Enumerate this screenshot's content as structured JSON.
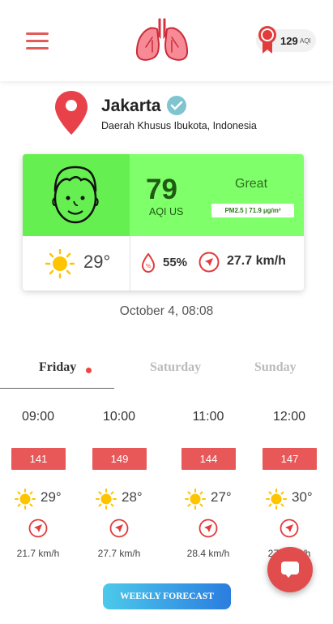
{
  "header": {
    "aqi_value": "129",
    "aqi_unit": "AQI"
  },
  "location": {
    "city": "Jakarta",
    "region": "Daerah Khusus Ibukota, Indonesia"
  },
  "current": {
    "aqi": "79",
    "aqi_label": "AQI US",
    "status": "Great",
    "pm25": "PM2.5 | 71.9 µg/m³",
    "temperature": "29°",
    "humidity": "55%",
    "wind": "27.7 km/h"
  },
  "datetime": "October 4, 08:08",
  "tabs": [
    "Friday",
    "Saturday",
    "Sunday"
  ],
  "hourly": [
    {
      "time": "09:00",
      "aqi": "141",
      "temp": "29°",
      "wind": "21.7 km/h"
    },
    {
      "time": "10:00",
      "aqi": "149",
      "temp": "28°",
      "wind": "27.7 km/h"
    },
    {
      "time": "11:00",
      "aqi": "144",
      "temp": "27°",
      "wind": "28.4 km/h"
    },
    {
      "time": "12:00",
      "aqi": "147",
      "temp": "30°",
      "wind": "27.7 km/h"
    }
  ],
  "weekly_button": "WEEKLY FORECAST",
  "colors": {
    "accent": "#e15b5b",
    "good_green": "#7fff6a",
    "aqi_box": "#e85858"
  }
}
